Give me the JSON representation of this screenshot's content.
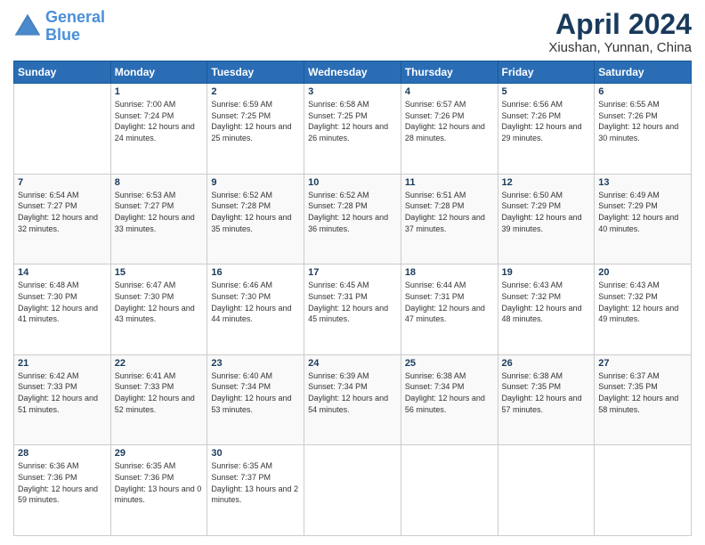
{
  "logo": {
    "line1": "General",
    "line2": "Blue"
  },
  "title": "April 2024",
  "subtitle": "Xiushan, Yunnan, China",
  "days_header": [
    "Sunday",
    "Monday",
    "Tuesday",
    "Wednesday",
    "Thursday",
    "Friday",
    "Saturday"
  ],
  "weeks": [
    [
      {
        "day": "",
        "sunrise": "",
        "sunset": "",
        "daylight": ""
      },
      {
        "day": "1",
        "sunrise": "Sunrise: 7:00 AM",
        "sunset": "Sunset: 7:24 PM",
        "daylight": "Daylight: 12 hours and 24 minutes."
      },
      {
        "day": "2",
        "sunrise": "Sunrise: 6:59 AM",
        "sunset": "Sunset: 7:25 PM",
        "daylight": "Daylight: 12 hours and 25 minutes."
      },
      {
        "day": "3",
        "sunrise": "Sunrise: 6:58 AM",
        "sunset": "Sunset: 7:25 PM",
        "daylight": "Daylight: 12 hours and 26 minutes."
      },
      {
        "day": "4",
        "sunrise": "Sunrise: 6:57 AM",
        "sunset": "Sunset: 7:26 PM",
        "daylight": "Daylight: 12 hours and 28 minutes."
      },
      {
        "day": "5",
        "sunrise": "Sunrise: 6:56 AM",
        "sunset": "Sunset: 7:26 PM",
        "daylight": "Daylight: 12 hours and 29 minutes."
      },
      {
        "day": "6",
        "sunrise": "Sunrise: 6:55 AM",
        "sunset": "Sunset: 7:26 PM",
        "daylight": "Daylight: 12 hours and 30 minutes."
      }
    ],
    [
      {
        "day": "7",
        "sunrise": "Sunrise: 6:54 AM",
        "sunset": "Sunset: 7:27 PM",
        "daylight": "Daylight: 12 hours and 32 minutes."
      },
      {
        "day": "8",
        "sunrise": "Sunrise: 6:53 AM",
        "sunset": "Sunset: 7:27 PM",
        "daylight": "Daylight: 12 hours and 33 minutes."
      },
      {
        "day": "9",
        "sunrise": "Sunrise: 6:52 AM",
        "sunset": "Sunset: 7:28 PM",
        "daylight": "Daylight: 12 hours and 35 minutes."
      },
      {
        "day": "10",
        "sunrise": "Sunrise: 6:52 AM",
        "sunset": "Sunset: 7:28 PM",
        "daylight": "Daylight: 12 hours and 36 minutes."
      },
      {
        "day": "11",
        "sunrise": "Sunrise: 6:51 AM",
        "sunset": "Sunset: 7:28 PM",
        "daylight": "Daylight: 12 hours and 37 minutes."
      },
      {
        "day": "12",
        "sunrise": "Sunrise: 6:50 AM",
        "sunset": "Sunset: 7:29 PM",
        "daylight": "Daylight: 12 hours and 39 minutes."
      },
      {
        "day": "13",
        "sunrise": "Sunrise: 6:49 AM",
        "sunset": "Sunset: 7:29 PM",
        "daylight": "Daylight: 12 hours and 40 minutes."
      }
    ],
    [
      {
        "day": "14",
        "sunrise": "Sunrise: 6:48 AM",
        "sunset": "Sunset: 7:30 PM",
        "daylight": "Daylight: 12 hours and 41 minutes."
      },
      {
        "day": "15",
        "sunrise": "Sunrise: 6:47 AM",
        "sunset": "Sunset: 7:30 PM",
        "daylight": "Daylight: 12 hours and 43 minutes."
      },
      {
        "day": "16",
        "sunrise": "Sunrise: 6:46 AM",
        "sunset": "Sunset: 7:30 PM",
        "daylight": "Daylight: 12 hours and 44 minutes."
      },
      {
        "day": "17",
        "sunrise": "Sunrise: 6:45 AM",
        "sunset": "Sunset: 7:31 PM",
        "daylight": "Daylight: 12 hours and 45 minutes."
      },
      {
        "day": "18",
        "sunrise": "Sunrise: 6:44 AM",
        "sunset": "Sunset: 7:31 PM",
        "daylight": "Daylight: 12 hours and 47 minutes."
      },
      {
        "day": "19",
        "sunrise": "Sunrise: 6:43 AM",
        "sunset": "Sunset: 7:32 PM",
        "daylight": "Daylight: 12 hours and 48 minutes."
      },
      {
        "day": "20",
        "sunrise": "Sunrise: 6:43 AM",
        "sunset": "Sunset: 7:32 PM",
        "daylight": "Daylight: 12 hours and 49 minutes."
      }
    ],
    [
      {
        "day": "21",
        "sunrise": "Sunrise: 6:42 AM",
        "sunset": "Sunset: 7:33 PM",
        "daylight": "Daylight: 12 hours and 51 minutes."
      },
      {
        "day": "22",
        "sunrise": "Sunrise: 6:41 AM",
        "sunset": "Sunset: 7:33 PM",
        "daylight": "Daylight: 12 hours and 52 minutes."
      },
      {
        "day": "23",
        "sunrise": "Sunrise: 6:40 AM",
        "sunset": "Sunset: 7:34 PM",
        "daylight": "Daylight: 12 hours and 53 minutes."
      },
      {
        "day": "24",
        "sunrise": "Sunrise: 6:39 AM",
        "sunset": "Sunset: 7:34 PM",
        "daylight": "Daylight: 12 hours and 54 minutes."
      },
      {
        "day": "25",
        "sunrise": "Sunrise: 6:38 AM",
        "sunset": "Sunset: 7:34 PM",
        "daylight": "Daylight: 12 hours and 56 minutes."
      },
      {
        "day": "26",
        "sunrise": "Sunrise: 6:38 AM",
        "sunset": "Sunset: 7:35 PM",
        "daylight": "Daylight: 12 hours and 57 minutes."
      },
      {
        "day": "27",
        "sunrise": "Sunrise: 6:37 AM",
        "sunset": "Sunset: 7:35 PM",
        "daylight": "Daylight: 12 hours and 58 minutes."
      }
    ],
    [
      {
        "day": "28",
        "sunrise": "Sunrise: 6:36 AM",
        "sunset": "Sunset: 7:36 PM",
        "daylight": "Daylight: 12 hours and 59 minutes."
      },
      {
        "day": "29",
        "sunrise": "Sunrise: 6:35 AM",
        "sunset": "Sunset: 7:36 PM",
        "daylight": "Daylight: 13 hours and 0 minutes."
      },
      {
        "day": "30",
        "sunrise": "Sunrise: 6:35 AM",
        "sunset": "Sunset: 7:37 PM",
        "daylight": "Daylight: 13 hours and 2 minutes."
      },
      {
        "day": "",
        "sunrise": "",
        "sunset": "",
        "daylight": ""
      },
      {
        "day": "",
        "sunrise": "",
        "sunset": "",
        "daylight": ""
      },
      {
        "day": "",
        "sunrise": "",
        "sunset": "",
        "daylight": ""
      },
      {
        "day": "",
        "sunrise": "",
        "sunset": "",
        "daylight": ""
      }
    ]
  ]
}
